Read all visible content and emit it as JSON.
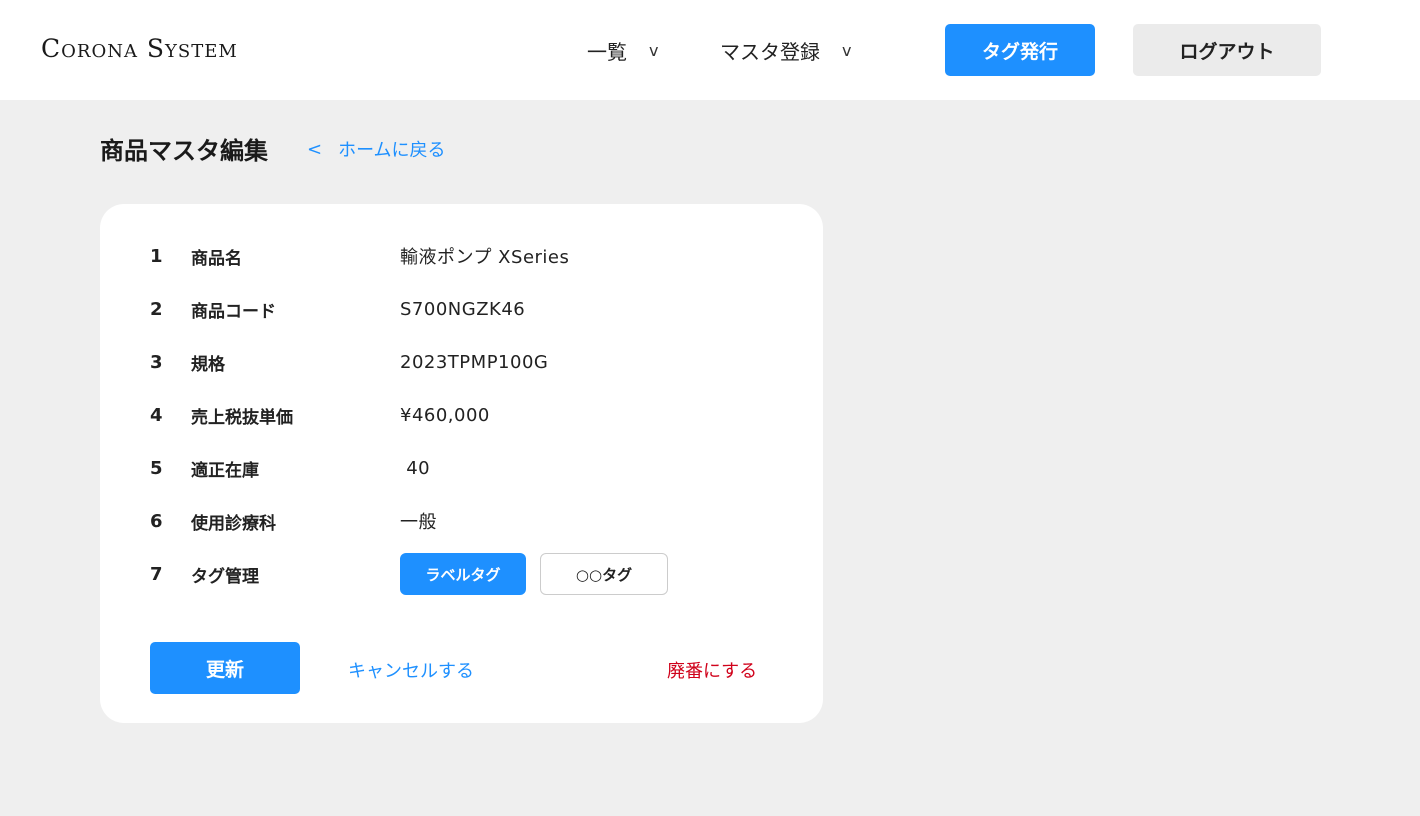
{
  "header": {
    "logo": "Corona System",
    "nav": [
      {
        "label": "一覧",
        "chevron": "v"
      },
      {
        "label": "マスタ登録",
        "chevron": "v"
      }
    ],
    "tag_issue_label": "タグ発行",
    "logout_label": "ログアウト"
  },
  "page": {
    "title": "商品マスタ編集",
    "back_chevron": "<",
    "back_label": "ホームに戻る"
  },
  "form": {
    "rows": [
      {
        "num": "1",
        "label": "商品名",
        "value": "輸液ポンプ XSeries"
      },
      {
        "num": "2",
        "label": "商品コード",
        "value": "S700NGZK46"
      },
      {
        "num": "3",
        "label": "規格",
        "value": "2023TPMP100G"
      },
      {
        "num": "4",
        "label": "売上税抜単価",
        "value": "¥460,000"
      },
      {
        "num": "5",
        "label": "適正在庫",
        "value": " 40"
      },
      {
        "num": "6",
        "label": "使用診療科",
        "value": "一般"
      },
      {
        "num": "7",
        "label": "タグ管理"
      }
    ],
    "tags": [
      {
        "label": "ラベルタグ",
        "selected": true
      },
      {
        "label": "○○タグ",
        "selected": false
      }
    ],
    "update_label": "更新",
    "cancel_label": "キャンセルする",
    "discontinue_label": "廃番にする"
  },
  "colors": {
    "accent": "#1e90ff",
    "danger": "#d0021b",
    "background": "#efefef",
    "card": "#ffffff",
    "secondary_button": "#ebebeb"
  }
}
